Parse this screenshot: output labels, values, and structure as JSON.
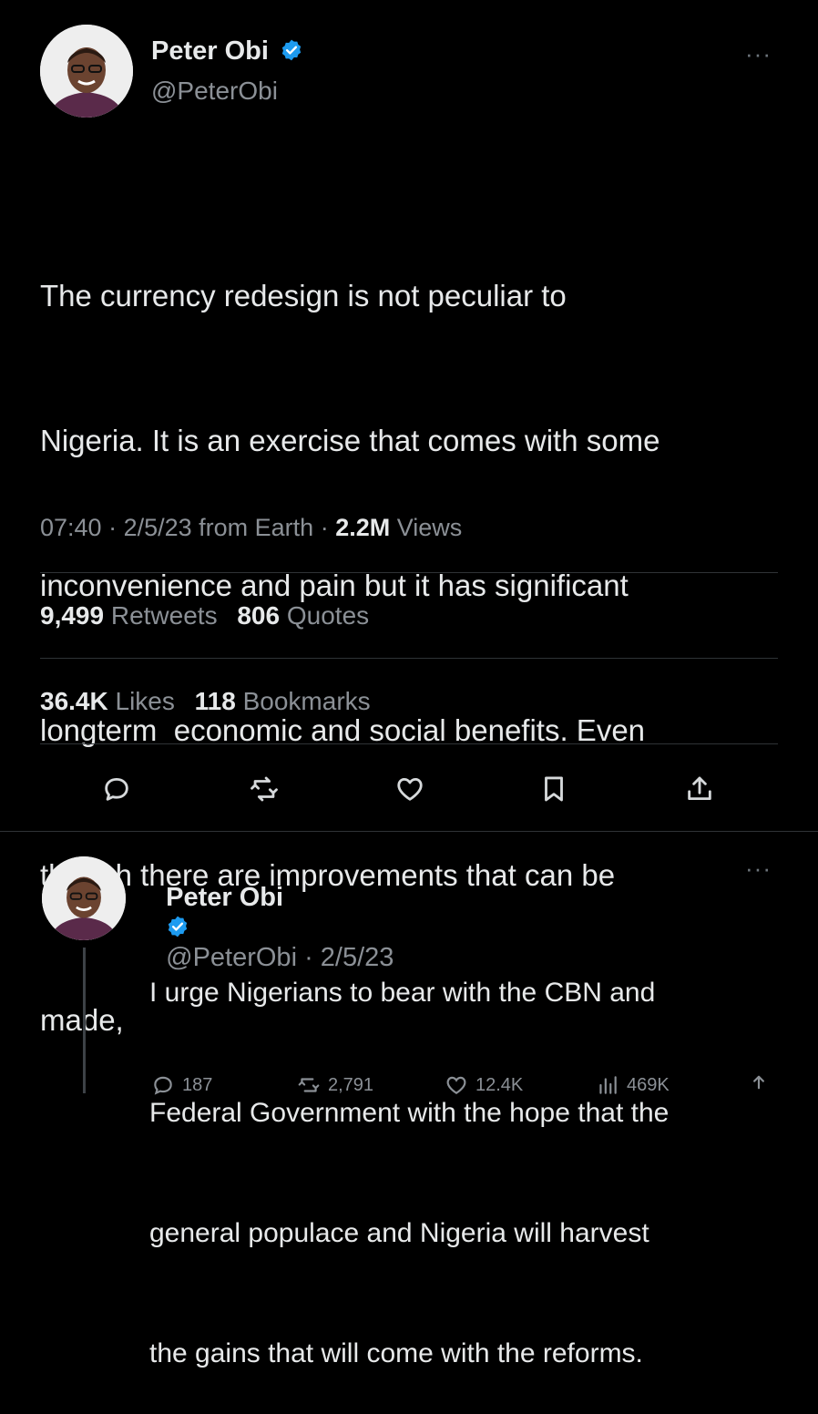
{
  "main_tweet": {
    "author_name": "Peter Obi",
    "handle": "@PeterObi",
    "more": "···",
    "text_lines": [
      "The currency redesign is not peculiar to",
      "Nigeria. It is an exercise that comes with some",
      "inconvenience and pain but it has significant",
      "longterm  economic and social benefits. Even",
      "though there are improvements that can be",
      "made,"
    ],
    "meta": {
      "time": "07:40",
      "sep1": " · ",
      "date": "2/5/23",
      "source": " from Earth",
      "sep2": " · ",
      "views_count": "2.2M",
      "views_label": " Views"
    },
    "stats": {
      "retweets_count": "9,499",
      "retweets_label": "Retweets",
      "quotes_count": "806",
      "quotes_label": "Quotes",
      "likes_count": "36.4K",
      "likes_label": "Likes",
      "bookmarks_count": "118",
      "bookmarks_label": "Bookmarks"
    },
    "actions": [
      "reply-icon",
      "retweet-icon",
      "like-icon",
      "bookmark-icon",
      "share-icon"
    ]
  },
  "reply_tweet": {
    "author_name": "Peter Obi",
    "handle_date": "@PeterObi · 2/5/23",
    "more": "···",
    "text_lines": [
      "I urge Nigerians to bear with the CBN and",
      "Federal Government with the hope that the",
      "general populace and Nigeria will harvest",
      "the gains that will come with the reforms."
    ],
    "counts": {
      "replies": "187",
      "retweets": "2,791",
      "likes": "12.4K",
      "views": "469K"
    }
  },
  "colors": {
    "background": "#000000",
    "text": "#e7e9ea",
    "muted": "#8b9096",
    "verified": "#1d9bf0",
    "divider": "#2f3336"
  }
}
